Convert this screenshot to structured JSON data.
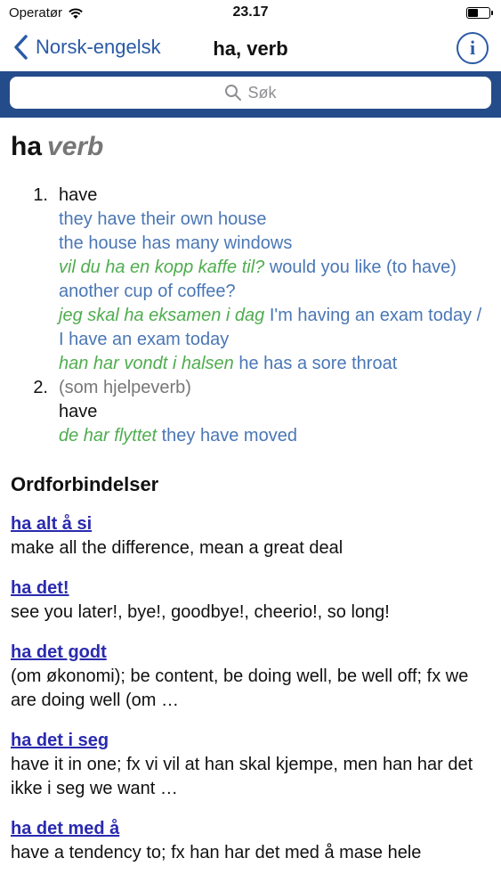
{
  "status": {
    "carrier": "Operatør",
    "time": "23.17",
    "battery_level": 0.45
  },
  "nav": {
    "back_label": "Norsk-engelsk",
    "title": "ha, verb",
    "info_label": "i"
  },
  "search": {
    "placeholder": "Søk"
  },
  "entry": {
    "word": "ha",
    "pos": "verb",
    "senses": [
      {
        "num": "1.",
        "translation": "have",
        "examples": [
          {
            "src": "",
            "tgt": "they have their own house"
          },
          {
            "src": "",
            "tgt": "the house has many windows"
          },
          {
            "src": "vil du ha en kopp kaffe til?",
            "tgt": "would you like (to have) another cup of coffee?"
          },
          {
            "src": "jeg skal ha eksamen i dag",
            "tgt": "I'm having an exam today / I have an exam today"
          },
          {
            "src": "han har vondt i halsen",
            "tgt": "he has a sore throat"
          }
        ]
      },
      {
        "num": "2.",
        "note": "(som hjelpeverb)",
        "translation": "have",
        "examples": [
          {
            "src": "de har flyttet",
            "tgt": "they have moved"
          }
        ]
      }
    ]
  },
  "phrases": {
    "title": "Ordforbindelser",
    "items": [
      {
        "phrase": "ha alt å si",
        "definition": "make all the difference, mean a great deal"
      },
      {
        "phrase": "ha det!",
        "definition": "see you later!, bye!, goodbye!, cheerio!, so long!"
      },
      {
        "phrase": "ha det godt",
        "definition": "(om økonomi); be content, be doing well, be well off; fx we are doing well (om …"
      },
      {
        "phrase": "ha det i seg",
        "definition": "have it in one; fx vi vil at han skal kjempe, men han har det ikke i seg we want …"
      },
      {
        "phrase": "ha det med å",
        "definition": "have a tendency to; fx han har det med å mase hele"
      }
    ]
  }
}
